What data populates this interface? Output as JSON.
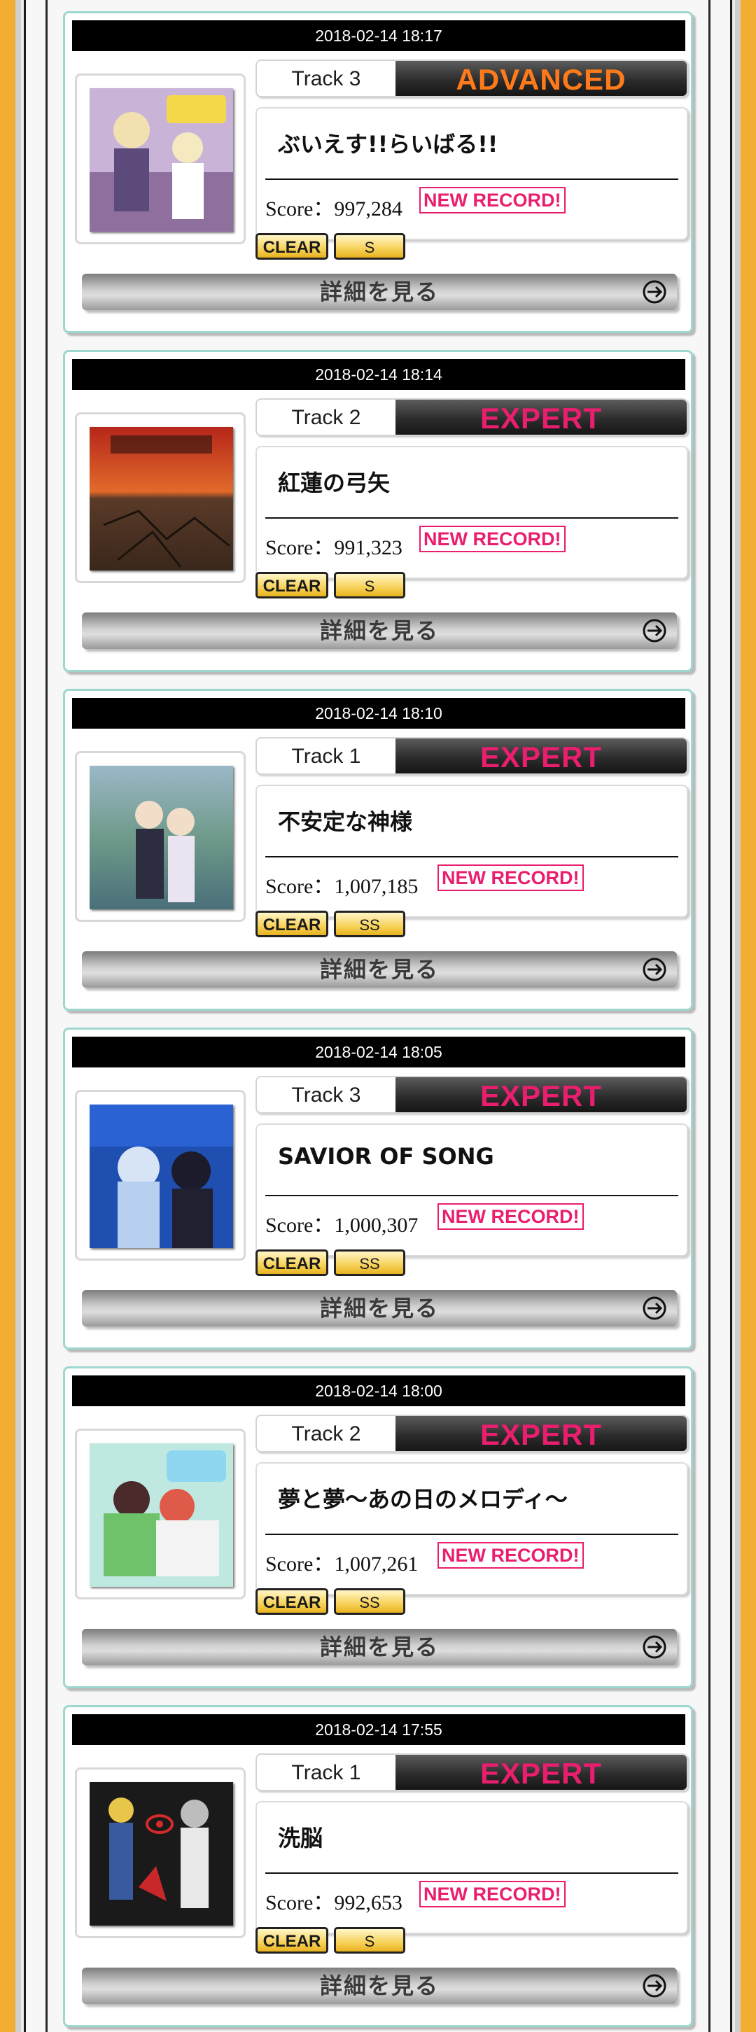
{
  "detail_label": "詳細を見る",
  "score_prefix": "Score：",
  "colors": {
    "side": "#f2ad33",
    "advanced": "#ff7a1a",
    "expert": "#ea1e6e",
    "card_border": "#9ed7cf"
  },
  "plays": [
    {
      "date": "2018-02-14 18:17",
      "track": "Track 3",
      "difficulty": "ADVANCED",
      "title": "ぶいえす!!らいばる!!",
      "score": "997,284",
      "new_record": "NEW RECORD!",
      "clear": "CLEAR",
      "rank": "S"
    },
    {
      "date": "2018-02-14 18:14",
      "track": "Track 2",
      "difficulty": "EXPERT",
      "title": "紅蓮の弓矢",
      "score": "991,323",
      "new_record": "NEW RECORD!",
      "clear": "CLEAR",
      "rank": "S"
    },
    {
      "date": "2018-02-14 18:10",
      "track": "Track 1",
      "difficulty": "EXPERT",
      "title": "不安定な神様",
      "score": "1,007,185",
      "new_record": "NEW RECORD!",
      "clear": "CLEAR",
      "rank": "SS"
    },
    {
      "date": "2018-02-14 18:05",
      "track": "Track 3",
      "difficulty": "EXPERT",
      "title": "SAVIOR OF SONG",
      "score": "1,000,307",
      "new_record": "NEW RECORD!",
      "clear": "CLEAR",
      "rank": "SS"
    },
    {
      "date": "2018-02-14 18:00",
      "track": "Track 2",
      "difficulty": "EXPERT",
      "title": "夢と夢～あの日のメロディ～",
      "score": "1,007,261",
      "new_record": "NEW RECORD!",
      "clear": "CLEAR",
      "rank": "SS"
    },
    {
      "date": "2018-02-14 17:55",
      "track": "Track 1",
      "difficulty": "EXPERT",
      "title": "洗脳",
      "score": "992,653",
      "new_record": "NEW RECORD!",
      "clear": "CLEAR",
      "rank": "S"
    }
  ],
  "jacket_icons": [
    "jacket-image-icon",
    "jacket-image-icon",
    "jacket-image-icon",
    "jacket-image-icon",
    "jacket-image-icon",
    "jacket-image-icon"
  ]
}
